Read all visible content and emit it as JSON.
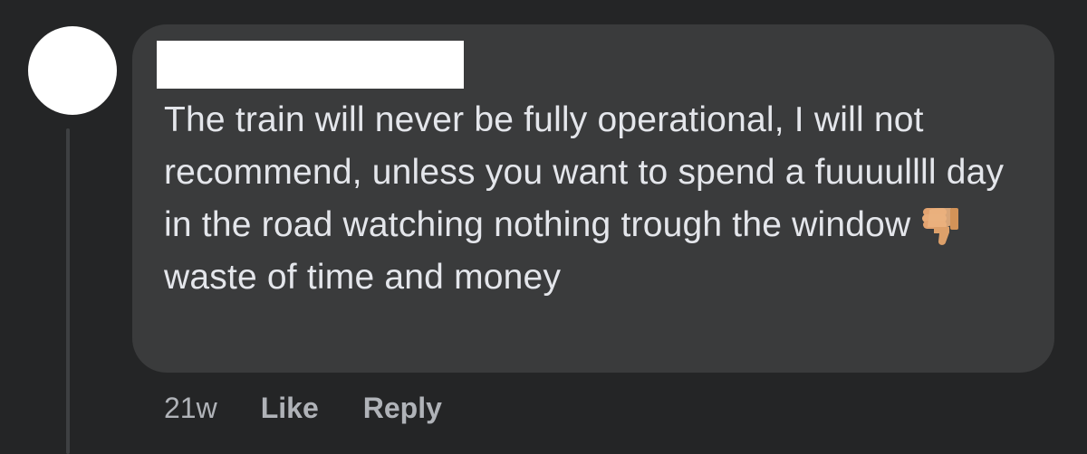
{
  "comment": {
    "author_name": "",
    "text_before_emoji": "The train will never be fully operational, I will not recommend, unless you want to spend a fuuuullll day in the road watching nothing trough the window",
    "emoji": "thumbs-down-icon",
    "text_after_emoji": "waste of time and money",
    "timestamp": "21w",
    "like_label": "Like",
    "reply_label": "Reply"
  },
  "colors": {
    "page_background": "#242526",
    "bubble_background": "#3a3b3c",
    "text_primary": "#e4e6eb",
    "text_secondary": "#b0b3b8",
    "avatar_fill": "#ffffff",
    "redaction_fill": "#ffffff"
  }
}
